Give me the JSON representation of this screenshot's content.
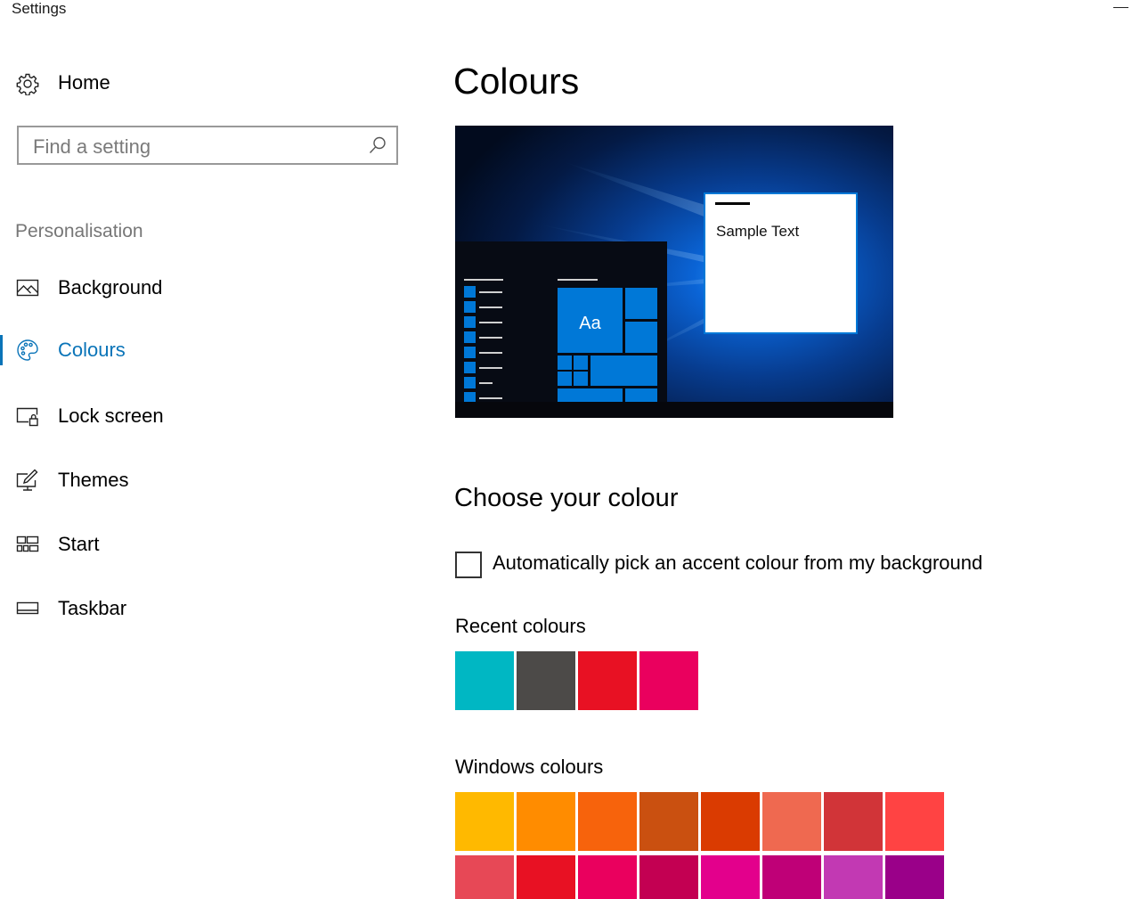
{
  "window": {
    "title": "Settings"
  },
  "sidebar": {
    "home_label": "Home",
    "search_placeholder": "Find a setting",
    "section_header": "Personalisation",
    "items": [
      {
        "label": "Background"
      },
      {
        "label": "Colours"
      },
      {
        "label": "Lock screen"
      },
      {
        "label": "Themes"
      },
      {
        "label": "Start"
      },
      {
        "label": "Taskbar"
      }
    ]
  },
  "main": {
    "title": "Colours",
    "preview": {
      "sample_text": "Sample Text",
      "tile_text": "Aa"
    },
    "choose_heading": "Choose your colour",
    "auto_pick_label": "Automatically pick an accent colour from my background",
    "auto_pick_checked": false,
    "recent_heading": "Recent colours",
    "recent_colours": [
      "#00b7c3",
      "#4c4a48",
      "#e81123",
      "#ea005e"
    ],
    "windows_heading": "Windows colours",
    "windows_colours_row1": [
      "#ffb900",
      "#ff8c00",
      "#f7630c",
      "#ca5010",
      "#da3b01",
      "#ef6950",
      "#d13438",
      "#ff4343"
    ],
    "windows_colours_row2": [
      "#e74856",
      "#e81123",
      "#ea005e",
      "#c30052",
      "#e3008c",
      "#bf0077",
      "#c239b3",
      "#9a0089"
    ]
  },
  "colors": {
    "accent": "#0a74b8",
    "preview_accent": "#0078d7"
  }
}
